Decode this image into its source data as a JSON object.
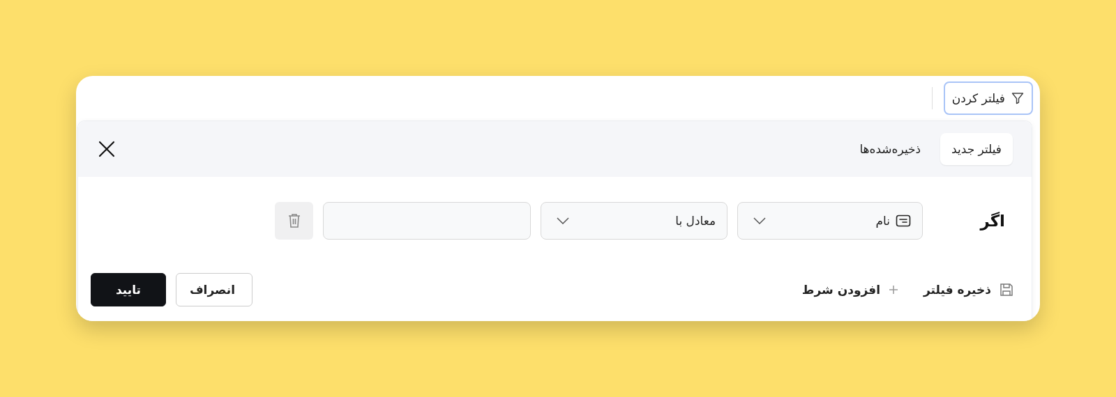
{
  "toolbar": {
    "filter_button": {
      "label": "فیلتر کردن",
      "selected": true
    }
  },
  "panel": {
    "tabs": [
      {
        "label": "فیلتر جدید",
        "selected": true
      },
      {
        "label": "ذخیره‌شده‌ها",
        "selected": false
      }
    ],
    "condition": {
      "prefix": "اگر",
      "field": "نام",
      "operator": "معادل با",
      "delete_disabled": true
    },
    "actions": [
      {
        "label": "ذخیره فیلتر",
        "kind": "save"
      },
      {
        "label": "افزودن شرط",
        "kind": "add"
      }
    ],
    "buttons": [
      {
        "label": "انصراف",
        "kind": "secondary"
      },
      {
        "label": "تایید",
        "kind": "primary"
      }
    ]
  }
}
